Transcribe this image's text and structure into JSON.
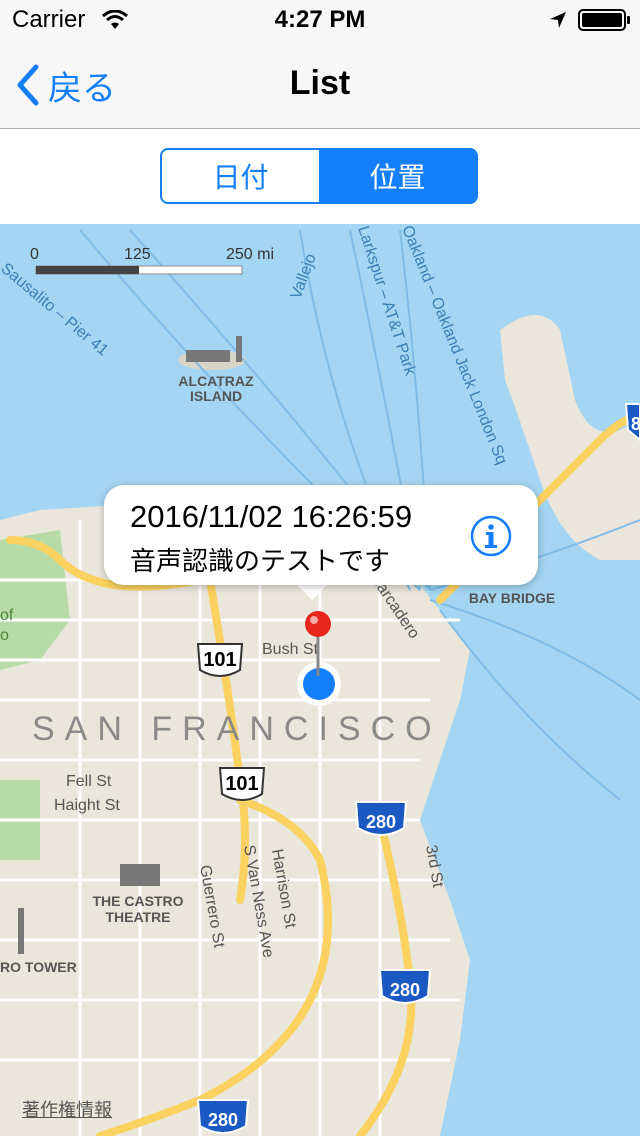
{
  "status_bar": {
    "carrier": "Carrier",
    "time": "4:27 PM"
  },
  "nav": {
    "back_label": "戻る",
    "title": "List"
  },
  "segment": {
    "items": [
      "日付",
      "位置"
    ],
    "selected_index": 1
  },
  "map": {
    "scale": {
      "labels": [
        "0",
        "125",
        "250 mi"
      ]
    },
    "labels": {
      "sausalito": "Sausalito – Pier 41",
      "vallejo": "Vallejo",
      "larkspur": "Larkspur – AT&T Park",
      "oakland": "Oakland – Oakland Jack London Sq",
      "alcatraz_1": "ALCATRAZ",
      "alcatraz_2": "ISLAND",
      "bay_bridge": "BAY BRIDGE",
      "embarcadero": "Embarcadero",
      "bush_st": "Bush St",
      "san_francisco": "SAN FRANCISCO",
      "fell_st": "Fell St",
      "haight_st": "Haight St",
      "castro_1": "THE CASTRO",
      "castro_2": "THEATRE",
      "s_van_ness": "S Van Ness Ave",
      "harrison_st": "Harrison St",
      "guerrero_st": "Guerrero St",
      "third_st": "3rd St",
      "tower": "RO TOWER",
      "park_1": "of",
      "park_2": "o"
    },
    "shields": {
      "us101_a": "101",
      "us101_b": "101",
      "i280_a": "280",
      "i280_b": "280",
      "i280_c": "280",
      "i80": "8"
    },
    "legal": "著作権情報",
    "colors": {
      "water": "#a4d5f2",
      "land": "#eae6dc",
      "highway": "#fbd160",
      "blue_dot": "#147efb",
      "pin": "#e8261e"
    }
  },
  "annotation": {
    "title": "2016/11/02 16:26:59",
    "subtitle": "音声認識のテストです"
  }
}
